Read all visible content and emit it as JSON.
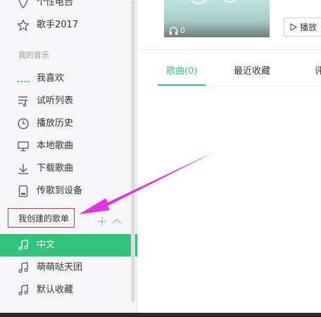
{
  "sidebar": {
    "items_top": [
      {
        "label": "个性电台",
        "icon": "radio-icon"
      },
      {
        "label": "歌手2017",
        "icon": "star-icon"
      }
    ],
    "my_music_title": "我的音乐",
    "my_music": [
      {
        "label": "我喜欢",
        "icon": "heart-bars-icon"
      },
      {
        "label": "试听列表",
        "icon": "playlist-icon"
      },
      {
        "label": "播放历史",
        "icon": "clock-icon"
      },
      {
        "label": "本地歌曲",
        "icon": "monitor-icon"
      },
      {
        "label": "下载歌曲",
        "icon": "download-icon"
      },
      {
        "label": "传歌到设备",
        "icon": "device-icon"
      }
    ],
    "created_playlists_title": "我创建的歌单",
    "playlists": [
      {
        "label": "中文",
        "icon": "music-note-icon",
        "active": true
      },
      {
        "label": "萌萌哒天团",
        "icon": "music-note-icon",
        "active": false
      },
      {
        "label": "默认收藏",
        "icon": "music-note-icon",
        "active": false
      }
    ]
  },
  "cover": {
    "listen_count": "0",
    "icon": "headphones-icon"
  },
  "play_button": {
    "label": "播放",
    "icon": "play-icon"
  },
  "tabs": [
    {
      "label": "歌曲(0)",
      "active": true
    },
    {
      "label": "最近收藏",
      "active": false
    },
    {
      "label": "评",
      "active": false
    }
  ],
  "colors": {
    "accent": "#31c27c",
    "highlight_box": "#d9362b",
    "annotation_arrow": "#e233e0",
    "sidebar_bg": "#f5f5f7"
  }
}
